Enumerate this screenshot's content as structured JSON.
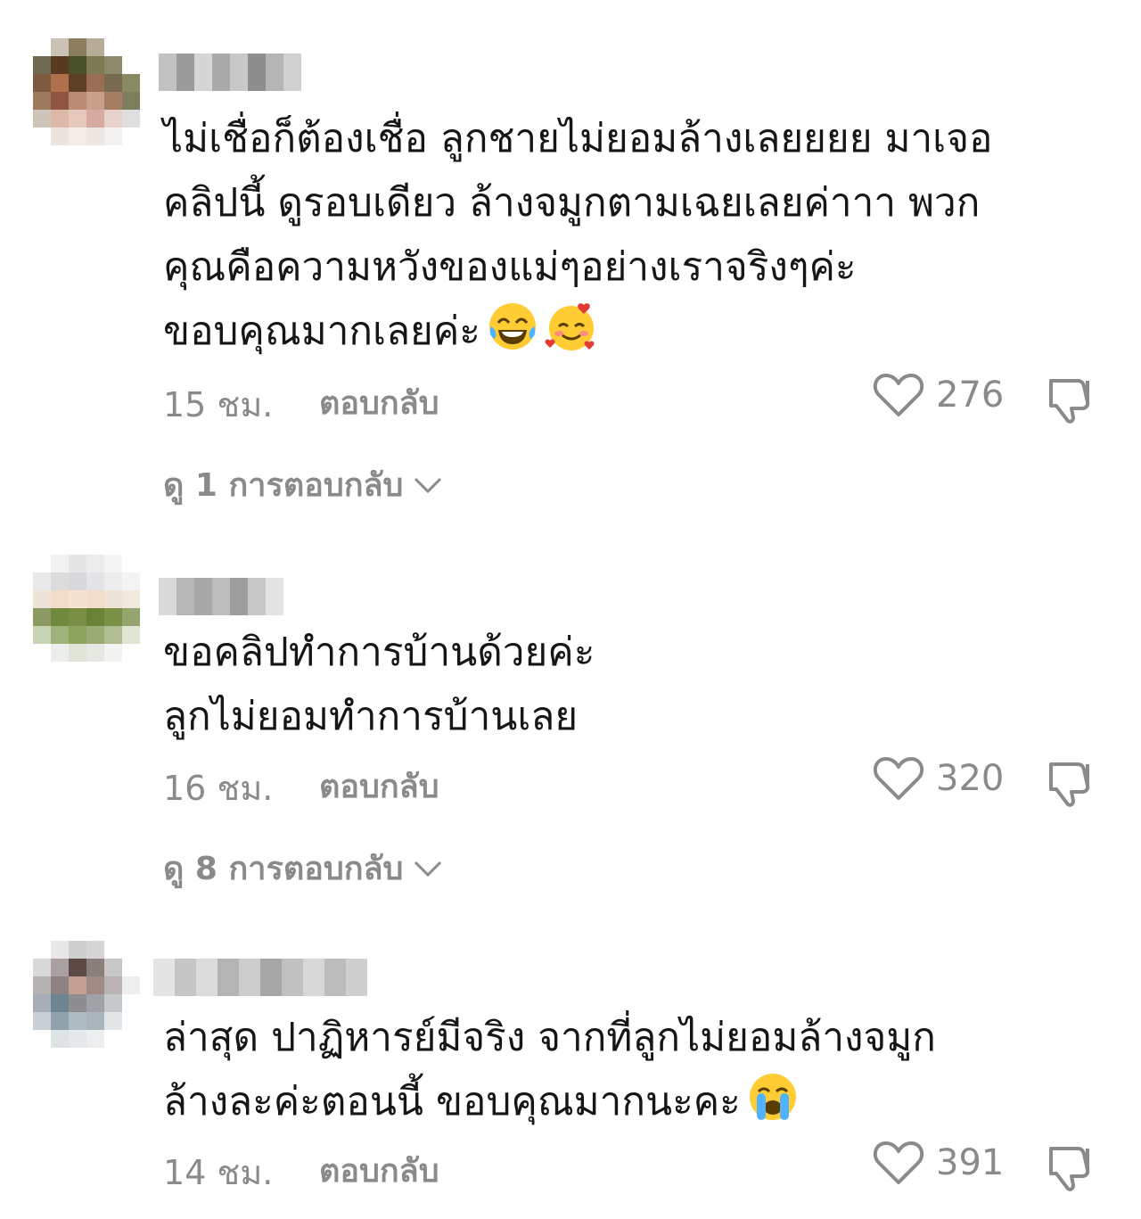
{
  "comments": [
    {
      "avatar_colors": [
        "#fff",
        "#c9c3b6",
        "#8c7d5e",
        "#b7ac98",
        "#fff",
        "#fff",
        "#6f6a4f",
        "#5a3b22",
        "#49512a",
        "#7e7a52",
        "#8d8a6b",
        "#fff",
        "#7e5a3f",
        "#b0704c",
        "#5b3f27",
        "#9a6e52",
        "#786a4e",
        "#8a8a62",
        "#9c7a5c",
        "#8e5540",
        "#ba8c74",
        "#c8a08c",
        "#a37d62",
        "#7e7d5e",
        "#cfc4b8",
        "#ddb8a6",
        "#e7c8bd",
        "#d6aaa0",
        "#e8d3cc",
        "#e0dfe0",
        "#fff",
        "#e9e4e0",
        "#f3ece8",
        "#ede7e4",
        "#f4f2f1",
        "#fff"
      ],
      "username_colors": [
        "#c2c2c2",
        "#9b9b9b",
        "#d5d5d5",
        "#aaaaaa",
        "#c8c8c8",
        "#8e8e8e",
        "#b5b5b5",
        "#d0d0d0"
      ],
      "lines": [
        "ไม่เชื่อก็ต้องเชื่อ ลูกชายไม่ยอมล้างเลยยยย มาเจอ",
        "คลิปนี้ ดูรอบเดียว ล้างจมูกตามเฉยเลยค่าาา พวก",
        "คุณคือความหวังของแม่ๆอย่างเราจริงๆค่ะ",
        "ขอบคุณมากเลยค่ะ"
      ],
      "emojis": [
        "tears-of-joy-emoji",
        "smiling-face-with-hearts-emoji"
      ],
      "time": "15 ชม.",
      "reply_label": "ตอบกลับ",
      "likes": "276",
      "view_replies": "ดู 1 การตอบกลับ"
    },
    {
      "avatar_colors": [
        "#fff",
        "#f2f2f2",
        "#e6e6e6",
        "#ececec",
        "#f5f5f5",
        "#fff",
        "#e9e9e9",
        "#dcdcdc",
        "#d8d8dc",
        "#e4e4e8",
        "#ededed",
        "#f4f4f4",
        "#f0e4d8",
        "#f3dcc8",
        "#f4e2d2",
        "#f1ddca",
        "#efe3d6",
        "#f3e8dc",
        "#8a9a62",
        "#6f8a3e",
        "#7a8f45",
        "#688236",
        "#7b9047",
        "#94a66e",
        "#c8d3b4",
        "#9fb27a",
        "#8ea35c",
        "#9bac73",
        "#b0bd93",
        "#dfe6d4",
        "#fff",
        "#eceeea",
        "#dfe3d8",
        "#e6e9e1",
        "#f3f4f1",
        "#fff"
      ],
      "username_colors": [
        "#dadada",
        "#b8b8b8",
        "#a8a8a8",
        "#bdbdbd",
        "#9e9e9e",
        "#c7c7c7",
        "#e3e3e3"
      ],
      "lines": [
        "ขอคลิปทำการบ้านด้วยค่ะ",
        "ลูกไม่ยอมทำการบ้านเลย"
      ],
      "emojis": [],
      "time": "16 ชม.",
      "reply_label": "ตอบกลับ",
      "likes": "320",
      "view_replies": "ดู 8 การตอบกลับ"
    },
    {
      "avatar_colors": [
        "#fff",
        "#e8e8e8",
        "#cfcfcf",
        "#d6d6d6",
        "#fff",
        "#fff",
        "#d9d9d9",
        "#a9a0a0",
        "#5c4a46",
        "#8b7f7c",
        "#c8c8c8",
        "#fff",
        "#b7b2b2",
        "#8f8282",
        "#c49f94",
        "#a08a84",
        "#b9b4b3",
        "#eeeeee",
        "#a7aeb5",
        "#6d8591",
        "#8e8d92",
        "#9fa3a8",
        "#c6c9cc",
        "#fff",
        "#c8d0d6",
        "#8fa2ad",
        "#b0bcc4",
        "#a9b4bb",
        "#e2e6e8",
        "#fff",
        "#fff",
        "#dee3e6",
        "#e5e8ea",
        "#eceef0",
        "#fff",
        "#fff"
      ],
      "username_colors": [
        "#e4e4e4",
        "#c6c6c6",
        "#dcdcdc",
        "#b4b4b4",
        "#cdcdcd",
        "#a6a6a6",
        "#c0c0c0",
        "#d8d8d8",
        "#bcbcbc",
        "#cfcfcf"
      ],
      "lines": [
        "ล่าสุด ปาฏิหารย์มีจริง จากที่ลูกไม่ยอมล้างจมูก",
        "ล้างละค่ะตอนนี้ ขอบคุณมากนะคะ"
      ],
      "emojis": [
        "loudly-crying-face-emoji"
      ],
      "time": "14 ชม.",
      "reply_label": "ตอบกลับ",
      "likes": "391",
      "view_replies": ""
    }
  ]
}
